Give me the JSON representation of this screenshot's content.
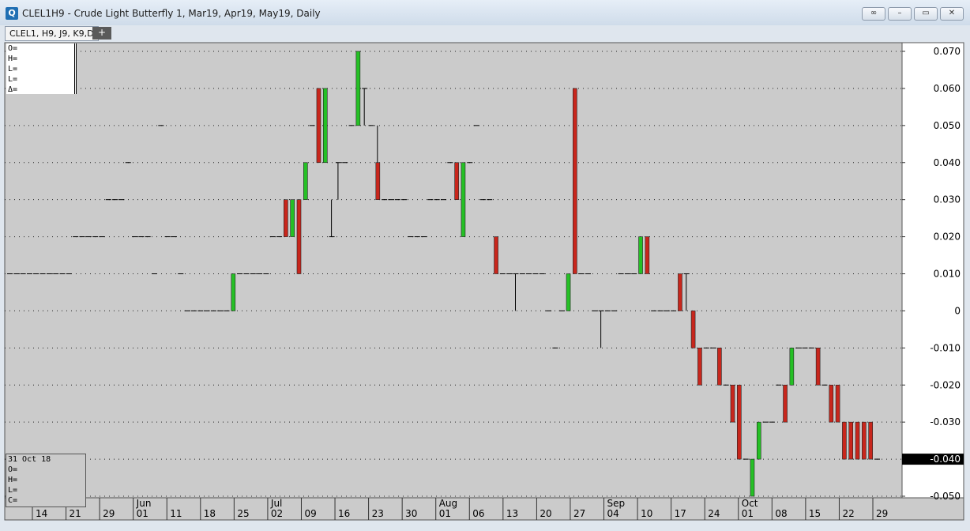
{
  "window": {
    "title": "CLEL1H9 - Crude Light Butterfly 1, Mar19, Apr19, May19, Daily",
    "icon": "chart-app-icon",
    "buttons": [
      "link-icon",
      "minimize-icon",
      "restore-icon",
      "close-icon"
    ]
  },
  "tabs": {
    "active": "CLEL1, H9, J9, K9,D",
    "add": "+"
  },
  "ohlc_box": [
    "O=",
    "H=",
    "L=",
    "L=",
    "Δ="
  ],
  "date_box": {
    "date": "31 Oct 18",
    "fields": [
      "O=",
      "H=",
      "L=",
      "C="
    ]
  },
  "last_price": "-0.040",
  "colors": {
    "up": "#25c025",
    "down": "#c8261c",
    "background": "#cbcbcb",
    "price_tag": "#000000"
  },
  "chart_data": {
    "type": "bar",
    "ylim": [
      -0.05,
      0.07
    ],
    "yticks": [
      "0.070",
      "0.060",
      "0.050",
      "0.040",
      "0.030",
      "0.020",
      "0.010",
      "0",
      "-0.010",
      "-0.020",
      "-0.030",
      "-0.040",
      "-0.050"
    ],
    "ytick_values": [
      0.07,
      0.06,
      0.05,
      0.04,
      0.03,
      0.02,
      0.01,
      0,
      -0.01,
      -0.02,
      -0.03,
      -0.04,
      -0.05
    ],
    "xticks": [
      "14",
      "21",
      "29",
      "01",
      "11",
      "18",
      "25",
      "02",
      "09",
      "16",
      "23",
      "30",
      "01",
      "06",
      "13",
      "20",
      "27",
      "04",
      "10",
      "17",
      "24",
      "01",
      "08",
      "15",
      "22",
      "29"
    ],
    "month_labels": [
      "Jun",
      "Jul",
      "Aug",
      "Sep",
      "Oct"
    ],
    "grid": true,
    "series": [
      {
        "values": [
          [
            0.01,
            0.01,
            0.01,
            0.01
          ],
          [
            0.01,
            0.01,
            0.01,
            0.01
          ],
          [
            0.01,
            0.01,
            0.01,
            0.01
          ],
          [
            0.01,
            0.01,
            0.01,
            0.01
          ],
          [
            0.01,
            0.01,
            0.01,
            0.01
          ],
          [
            0.01,
            0.01,
            0.01,
            0.01
          ],
          [
            0.01,
            0.01,
            0.01,
            0.01
          ],
          [
            0.01,
            0.01,
            0.01,
            0.01
          ],
          [
            0.01,
            0.01,
            0.01,
            0.01
          ],
          [
            0.01,
            0.01,
            0.01,
            0.01
          ],
          [
            0.02,
            0.02,
            0.02,
            0.02
          ],
          [
            0.02,
            0.02,
            0.02,
            0.02
          ],
          [
            0.02,
            0.02,
            0.02,
            0.02
          ],
          [
            0.02,
            0.02,
            0.02,
            0.02
          ],
          [
            0.02,
            0.02,
            0.02,
            0.02
          ],
          [
            0.03,
            0.03,
            0.03,
            0.03
          ],
          [
            0.03,
            0.03,
            0.03,
            0.03
          ],
          [
            0.03,
            0.03,
            0.03,
            0.03
          ],
          [
            0.04,
            0.04,
            0.04,
            0.04
          ],
          [
            0.02,
            0.02,
            0.02,
            0.02
          ],
          [
            0.02,
            0.02,
            0.02,
            0.02
          ],
          [
            0.02,
            0.02,
            0.02,
            0.02
          ],
          [
            0.01,
            0.01,
            0.01,
            0.01
          ],
          [
            0.05,
            0.05,
            0.05,
            0.05
          ],
          [
            0.02,
            0.02,
            0.02,
            0.02
          ],
          [
            0.02,
            0.02,
            0.02,
            0.02
          ],
          [
            0.01,
            0.01,
            0.01,
            0.01
          ],
          [
            0.0,
            0.0,
            0.0,
            0.0
          ],
          [
            0.0,
            0.0,
            0.0,
            0.0
          ],
          [
            0.0,
            0.0,
            0.0,
            0.0
          ],
          [
            0.0,
            0.0,
            0.0,
            0.0
          ],
          [
            0.0,
            0.0,
            0.0,
            0.0
          ],
          [
            0.0,
            0.0,
            0.0,
            0.0
          ],
          [
            0.0,
            0.0,
            0.0,
            0.0
          ],
          [
            0.0,
            0.0,
            0.0,
            0.01
          ],
          [
            0.01,
            0.01,
            0.01,
            0.01
          ],
          [
            0.01,
            0.01,
            0.01,
            0.01
          ],
          [
            0.01,
            0.01,
            0.01,
            0.01
          ],
          [
            0.01,
            0.01,
            0.01,
            0.01
          ],
          [
            0.01,
            0.01,
            0.01,
            0.01
          ],
          [
            0.02,
            0.02,
            0.02,
            0.02
          ],
          [
            0.02,
            0.02,
            0.02,
            0.02
          ],
          [
            0.03,
            0.03,
            0.02,
            0.02
          ],
          [
            0.02,
            0.02,
            0.02,
            0.03
          ],
          [
            0.03,
            0.03,
            0.01,
            0.01
          ],
          [
            0.03,
            0.04,
            0.03,
            0.04
          ],
          [
            0.05,
            0.05,
            0.05,
            0.05
          ],
          [
            0.06,
            0.06,
            0.04,
            0.04
          ],
          [
            0.04,
            0.06,
            0.04,
            0.06
          ],
          [
            0.02,
            0.03,
            0.02,
            0.02
          ],
          [
            0.04,
            0.04,
            0.03,
            0.04
          ],
          [
            0.04,
            0.04,
            0.04,
            0.04
          ],
          [
            0.05,
            0.05,
            0.05,
            0.05
          ],
          [
            0.05,
            0.07,
            0.05,
            0.07
          ],
          [
            0.06,
            0.06,
            0.05,
            0.06
          ],
          [
            0.05,
            0.05,
            0.05,
            0.05
          ],
          [
            0.04,
            0.05,
            0.03,
            0.03
          ],
          [
            0.03,
            0.03,
            0.03,
            0.03
          ],
          [
            0.03,
            0.03,
            0.03,
            0.03
          ],
          [
            0.03,
            0.03,
            0.03,
            0.03
          ],
          [
            0.03,
            0.03,
            0.03,
            0.03
          ],
          [
            0.02,
            0.02,
            0.02,
            0.02
          ],
          [
            0.02,
            0.02,
            0.02,
            0.02
          ],
          [
            0.02,
            0.02,
            0.02,
            0.02
          ],
          [
            0.03,
            0.03,
            0.03,
            0.03
          ],
          [
            0.03,
            0.03,
            0.03,
            0.03
          ],
          [
            0.03,
            0.03,
            0.03,
            0.03
          ],
          [
            0.04,
            0.04,
            0.04,
            0.04
          ],
          [
            0.04,
            0.04,
            0.03,
            0.03
          ],
          [
            0.02,
            0.04,
            0.02,
            0.04
          ],
          [
            0.04,
            0.04,
            0.04,
            0.04
          ],
          [
            0.05,
            0.05,
            0.05,
            0.05
          ],
          [
            0.03,
            0.03,
            0.03,
            0.03
          ],
          [
            0.03,
            0.03,
            0.03,
            0.03
          ],
          [
            0.02,
            0.02,
            0.01,
            0.01
          ],
          [
            0.01,
            0.01,
            0.01,
            0.01
          ],
          [
            0.01,
            0.01,
            0.01,
            0.01
          ],
          [
            0.01,
            0.01,
            0.0,
            0.01
          ],
          [
            0.01,
            0.01,
            0.01,
            0.01
          ],
          [
            0.01,
            0.01,
            0.01,
            0.01
          ],
          [
            0.01,
            0.01,
            0.01,
            0.01
          ],
          [
            0.01,
            0.01,
            0.01,
            0.01
          ],
          [
            0.0,
            0.0,
            0.0,
            0.0
          ],
          [
            -0.01,
            -0.01,
            -0.01,
            -0.01
          ],
          [
            0.0,
            0.0,
            0.0,
            0.0
          ],
          [
            0.0,
            0.01,
            0.0,
            0.01
          ],
          [
            0.06,
            0.06,
            0.01,
            0.01
          ],
          [
            0.01,
            0.01,
            0.01,
            0.01
          ],
          [
            0.01,
            0.01,
            0.01,
            0.01
          ],
          [
            0.0,
            0.0,
            0.0,
            0.0
          ],
          [
            0.0,
            0.0,
            -0.01,
            0.0
          ],
          [
            0.0,
            0.0,
            0.0,
            0.0
          ],
          [
            0.0,
            0.0,
            0.0,
            0.0
          ],
          [
            0.01,
            0.01,
            0.01,
            0.01
          ],
          [
            0.01,
            0.01,
            0.01,
            0.01
          ],
          [
            0.01,
            0.01,
            0.01,
            0.01
          ],
          [
            0.01,
            0.02,
            0.01,
            0.02
          ],
          [
            0.02,
            0.02,
            0.01,
            0.01
          ],
          [
            0.0,
            0.0,
            0.0,
            0.0
          ],
          [
            0.0,
            0.0,
            0.0,
            0.0
          ],
          [
            0.0,
            0.0,
            0.0,
            0.0
          ],
          [
            0.0,
            0.0,
            0.0,
            0.0
          ],
          [
            0.01,
            0.01,
            0.0,
            0.0
          ],
          [
            0.01,
            0.01,
            0.0,
            0.01
          ],
          [
            0.0,
            0.0,
            -0.01,
            -0.01
          ],
          [
            -0.01,
            -0.01,
            -0.02,
            -0.02
          ],
          [
            -0.01,
            -0.01,
            -0.01,
            -0.01
          ],
          [
            -0.01,
            -0.01,
            -0.01,
            -0.01
          ],
          [
            -0.01,
            -0.01,
            -0.02,
            -0.02
          ],
          [
            -0.02,
            -0.02,
            -0.02,
            -0.02
          ],
          [
            -0.02,
            -0.02,
            -0.03,
            -0.03
          ],
          [
            -0.02,
            -0.02,
            -0.04,
            -0.04
          ],
          [
            -0.04,
            -0.04,
            -0.04,
            -0.04
          ],
          [
            -0.05,
            -0.04,
            -0.05,
            -0.04
          ],
          [
            -0.04,
            -0.03,
            -0.04,
            -0.03
          ],
          [
            -0.03,
            -0.03,
            -0.03,
            -0.03
          ],
          [
            -0.03,
            -0.03,
            -0.03,
            -0.03
          ],
          [
            -0.02,
            -0.02,
            -0.02,
            -0.02
          ],
          [
            -0.02,
            -0.02,
            -0.03,
            -0.03
          ],
          [
            -0.02,
            -0.01,
            -0.02,
            -0.01
          ],
          [
            -0.01,
            -0.01,
            -0.01,
            -0.01
          ],
          [
            -0.01,
            -0.01,
            -0.01,
            -0.01
          ],
          [
            -0.01,
            -0.01,
            -0.01,
            -0.01
          ],
          [
            -0.01,
            -0.01,
            -0.02,
            -0.02
          ],
          [
            -0.02,
            -0.02,
            -0.02,
            -0.02
          ],
          [
            -0.02,
            -0.02,
            -0.03,
            -0.03
          ],
          [
            -0.02,
            -0.02,
            -0.03,
            -0.03
          ],
          [
            -0.03,
            -0.03,
            -0.04,
            -0.04
          ],
          [
            -0.03,
            -0.03,
            -0.04,
            -0.04
          ],
          [
            -0.03,
            -0.03,
            -0.04,
            -0.04
          ],
          [
            -0.03,
            -0.03,
            -0.04,
            -0.04
          ],
          [
            -0.03,
            -0.03,
            -0.04,
            -0.04
          ],
          [
            -0.04,
            -0.04,
            -0.04,
            -0.04
          ]
        ]
      }
    ]
  }
}
